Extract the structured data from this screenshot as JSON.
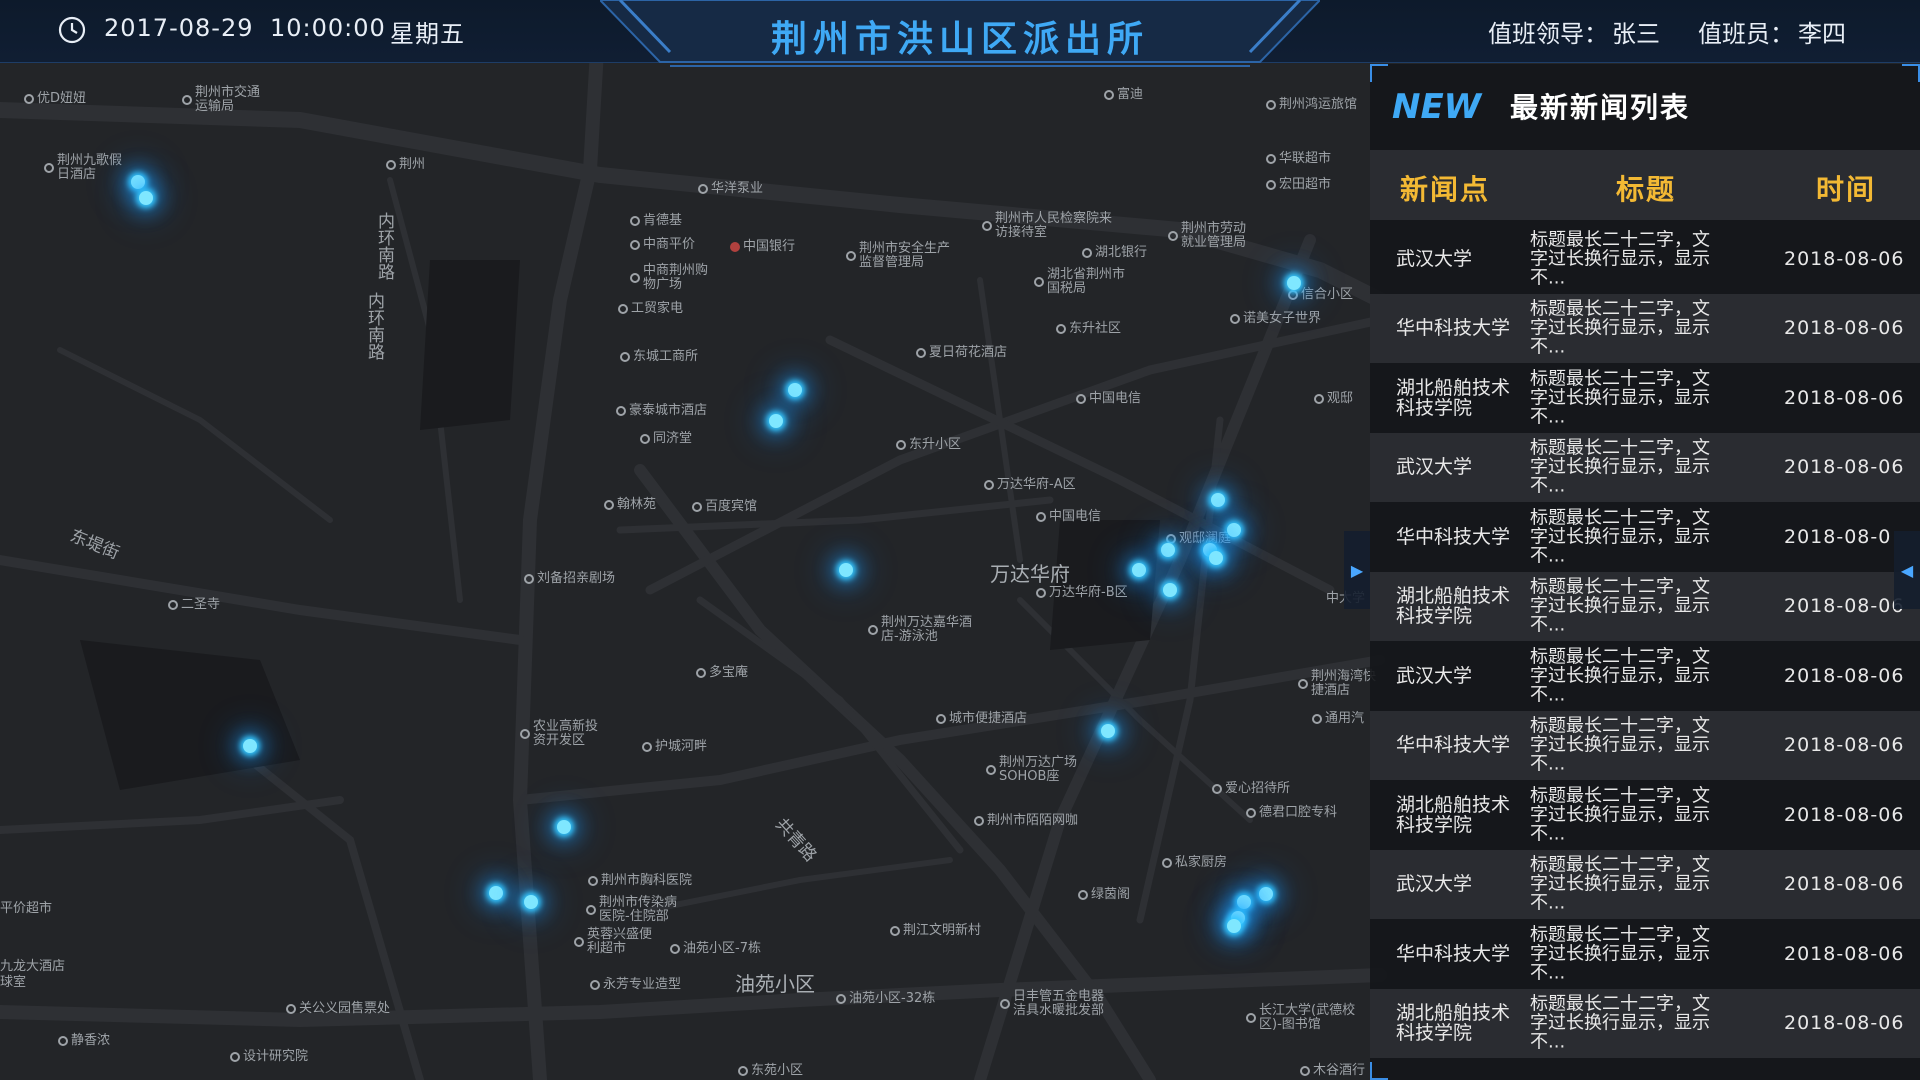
{
  "header": {
    "date": "2017-08-29",
    "time": "10:00:00",
    "weekday": "星期五",
    "title": "荆州市洪山区派出所",
    "leader_label": "值班领导：",
    "leader_name": "张三",
    "staff_label": "值班员：",
    "staff_name": "李四",
    "clock_icon": "clock-icon"
  },
  "map": {
    "roads": [
      "内环南路",
      "内环南路",
      "东堤街",
      "共青路"
    ],
    "areas": [
      "万达华府",
      "油苑小区"
    ],
    "pois": [
      "优D妞妞",
      "荆州市交通运输局",
      "荆州九歌假日酒店",
      "荆州",
      "华洋泵业",
      "肯德基",
      "中商平价",
      "中商荆州购物广场",
      "工贸家电",
      "中国银行",
      "荆州市安全生产监督管理局",
      "荆州市人民检察院来访接待室",
      "湖北银行",
      "湖北省荆州市国税局",
      "荆州市劳动就业管理局",
      "荆州鸿运旅馆",
      "华联超市",
      "宏田超市",
      "信合小区",
      "诺美女子世界",
      "富迪",
      "东城工商所",
      "豪泰城市酒店",
      "同济堂",
      "夏日荷花酒店",
      "东升社区",
      "中国电信",
      "观邸",
      "东升小区",
      "万达华府-A区",
      "中国电信",
      "翰林苑",
      "百度宾馆",
      "观邸澜庭",
      "刘备招亲剧场",
      "荆州万达嘉华酒店-游泳池",
      "万达华府-B区",
      "二圣寺",
      "多宝庵",
      "城市便捷酒店",
      "农业高新投资开发区",
      "护城河畔",
      "荆州万达广场SOHOB座",
      "荆州市陌陌网咖",
      "爱心招待所",
      "德君口腔专科",
      "通用汽",
      "荆州海湾快捷酒店",
      "私家厨房",
      "绿茵阁",
      "荆州市胸科医院",
      "荆州市传染病医院-住院部",
      "荆江文明新村",
      "英蓉兴盛便利超市",
      "油苑小区-7栋",
      "永芳专业造型",
      "关公义园售票处",
      "油苑小区-32栋",
      "日丰管五金电器洁具水暖批发部",
      "长江大学(武德校区)-图书馆",
      "静香浓",
      "设计研究院",
      "东苑小区",
      "平价超市",
      "九龙大酒店",
      "球室",
      "木谷酒行",
      "中大学"
    ]
  },
  "news": {
    "logo_text": "NEW",
    "title": "最新新闻列表",
    "columns": [
      "新闻点",
      "标题",
      "时间"
    ],
    "rows": [
      {
        "place": "武汉大学",
        "title": "标题最长二十二字，文字过长换行显示，显示不...",
        "time": "2018-08-06"
      },
      {
        "place": "华中科技大学",
        "title": "标题最长二十二字，文字过长换行显示，显示不...",
        "time": "2018-08-06"
      },
      {
        "place": "湖北船舶技术科技学院",
        "title": "标题最长二十二字，文字过长换行显示，显示不...",
        "time": "2018-08-06"
      },
      {
        "place": "武汉大学",
        "title": "标题最长二十二字，文字过长换行显示，显示不...",
        "time": "2018-08-06"
      },
      {
        "place": "华中科技大学",
        "title": "标题最长二十二字，文字过长换行显示，显示不...",
        "time": "2018-08-0"
      },
      {
        "place": "湖北船舶技术科技学院",
        "title": "标题最长二十二字，文字过长换行显示，显示不...",
        "time": "2018-08-06"
      },
      {
        "place": "武汉大学",
        "title": "标题最长二十二字，文字过长换行显示，显示不...",
        "time": "2018-08-06"
      },
      {
        "place": "华中科技大学",
        "title": "标题最长二十二字，文字过长换行显示，显示不...",
        "time": "2018-08-06"
      },
      {
        "place": "湖北船舶技术科技学院",
        "title": "标题最长二十二字，文字过长换行显示，显示不...",
        "time": "2018-08-06"
      },
      {
        "place": "武汉大学",
        "title": "标题最长二十二字，文字过长换行显示，显示不...",
        "time": "2018-08-06"
      },
      {
        "place": "华中科技大学",
        "title": "标题最长二十二字，文字过长换行显示，显示不...",
        "time": "2018-08-06"
      },
      {
        "place": "湖北船舶技术科技学院",
        "title": "标题最长二十二字，文字过长换行显示，显示不...",
        "time": "2018-08-06"
      }
    ],
    "collapse_icon": "chevron-right-icon",
    "expand_icon": "chevron-left-icon"
  },
  "colors": {
    "title_blue": "#3fa9f5",
    "header_gold": "#f3b934",
    "hotspot": "#7fe7ff",
    "map_bg": "#232528"
  }
}
